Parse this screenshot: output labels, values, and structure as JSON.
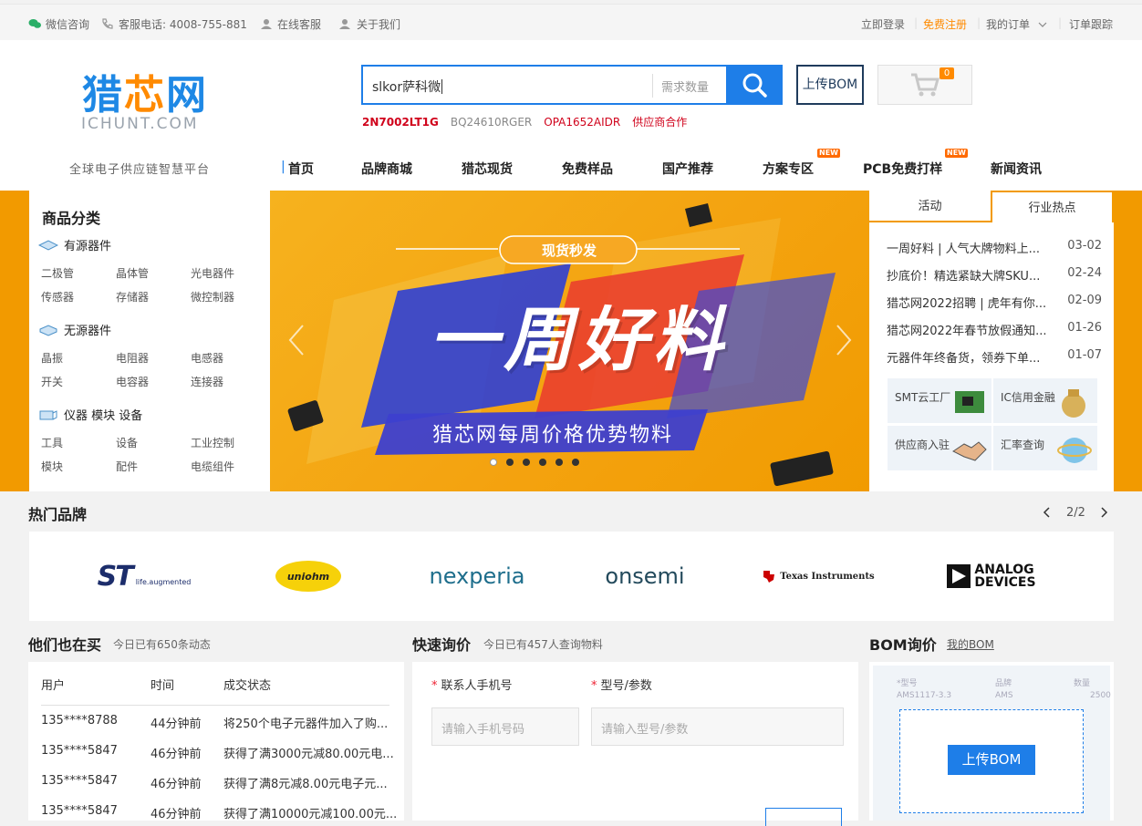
{
  "topbar": {
    "wechat": "微信咨询",
    "hotline": "客服电话: 4008-755-881",
    "online_service": "在线客服",
    "about": "关于我们",
    "login": "立即登录",
    "register": "免费注册",
    "my_orders": "我的订单",
    "order_track": "订单跟踪"
  },
  "logo": {
    "text_cn_1": "猎",
    "text_cn_2": "芯",
    "text_cn_3": "网",
    "text_en": "ICHUNT.COM"
  },
  "slogan": "全球电子供应链智慧平台",
  "search": {
    "value": "slkor萨科微",
    "qty_placeholder": "需求数量",
    "hot_words": [
      "2N7002LT1G",
      "BQ24610RGER",
      "OPA1652AIDR",
      "供应商合作"
    ]
  },
  "upload_bom": "上传BOM",
  "cart_count": "0",
  "nav": [
    {
      "label": "首页"
    },
    {
      "label": "品牌商城"
    },
    {
      "label": "猎芯现货"
    },
    {
      "label": "免费样品"
    },
    {
      "label": "国产推荐"
    },
    {
      "label": "方案专区",
      "tag": "NEW"
    },
    {
      "label": "PCB免费打样",
      "tag": "NEW"
    },
    {
      "label": "新闻资讯"
    }
  ],
  "categories": {
    "title": "商品分类",
    "groups": [
      {
        "name": "有源器件",
        "items": [
          "二极管",
          "晶体管",
          "光电器件",
          "传感器",
          "存储器",
          "微控制器"
        ]
      },
      {
        "name": "无源器件",
        "items": [
          "晶振",
          "电阻器",
          "电感器",
          "开关",
          "电容器",
          "连接器"
        ]
      },
      {
        "name": "仪器 模块 设备",
        "items": [
          "工具",
          "设备",
          "工业控制",
          "模块",
          "配件",
          "电缆组件"
        ]
      }
    ]
  },
  "banner": {
    "tag": "现货秒发",
    "headline": "一周好料",
    "subtitle": "猎芯网每周价格优势物料",
    "slides": 6,
    "active_slide": 0
  },
  "news": {
    "tabs": [
      "活动",
      "行业热点"
    ],
    "items": [
      {
        "title": "一周好料 | 人气大牌物料上...",
        "date": "03-02"
      },
      {
        "title": "抄底价！精选紧缺大牌SKU...",
        "date": "02-24"
      },
      {
        "title": "猎芯网2022招聘 | 虎年有你...",
        "date": "02-09"
      },
      {
        "title": "猎芯网2022年春节放假通知...",
        "date": "01-26"
      },
      {
        "title": "元器件年终备货，领券下单...",
        "date": "01-07"
      }
    ],
    "services": [
      "SMT云工厂",
      "IC信用金融",
      "供应商入驻",
      "汇率查询"
    ]
  },
  "hot_brands": {
    "title": "热门品牌",
    "page": "2/2",
    "brands": [
      "ST",
      "life.augmented",
      "uniohm",
      "nexperia",
      "onsemi",
      "Texas Instruments",
      "ANALOG",
      "DEVICES"
    ]
  },
  "buying": {
    "title": "他们也在买",
    "subtitle": "今日已有650条动态",
    "headers": [
      "用户",
      "时间",
      "成交状态"
    ],
    "rows": [
      {
        "user": "135****8788",
        "time": "44分钟前",
        "status": "将250个电子元器件加入了购..."
      },
      {
        "user": "135****5847",
        "time": "46分钟前",
        "status": "获得了满3000元减80.00元电..."
      },
      {
        "user": "135****5847",
        "time": "46分钟前",
        "status": "获得了满8元减8.00元电子元..."
      },
      {
        "user": "135****5847",
        "time": "46分钟前",
        "status": "获得了满10000元减100.00元..."
      }
    ]
  },
  "quick_quote": {
    "title": "快速询价",
    "subtitle": "今日已有457人查询物料",
    "phone_label": "联系人手机号",
    "phone_placeholder": "请输入手机号码",
    "model_label": "型号/参数",
    "model_placeholder": "请输入型号/参数"
  },
  "bom": {
    "title": "BOM询价",
    "my_bom": "我的BOM",
    "upload_btn": "上传BOM",
    "sheet_headers": [
      "*型号",
      "品牌",
      "数量"
    ],
    "sheet_rows": [
      {
        "model": "AMS1117-3.3",
        "brand": "AMS",
        "qty": "2500"
      }
    ]
  },
  "colors": {
    "accent": "#1e7ee8",
    "orange": "#f29a00",
    "new_tag": "#ff6a00",
    "hot_red": "#d0021b"
  }
}
